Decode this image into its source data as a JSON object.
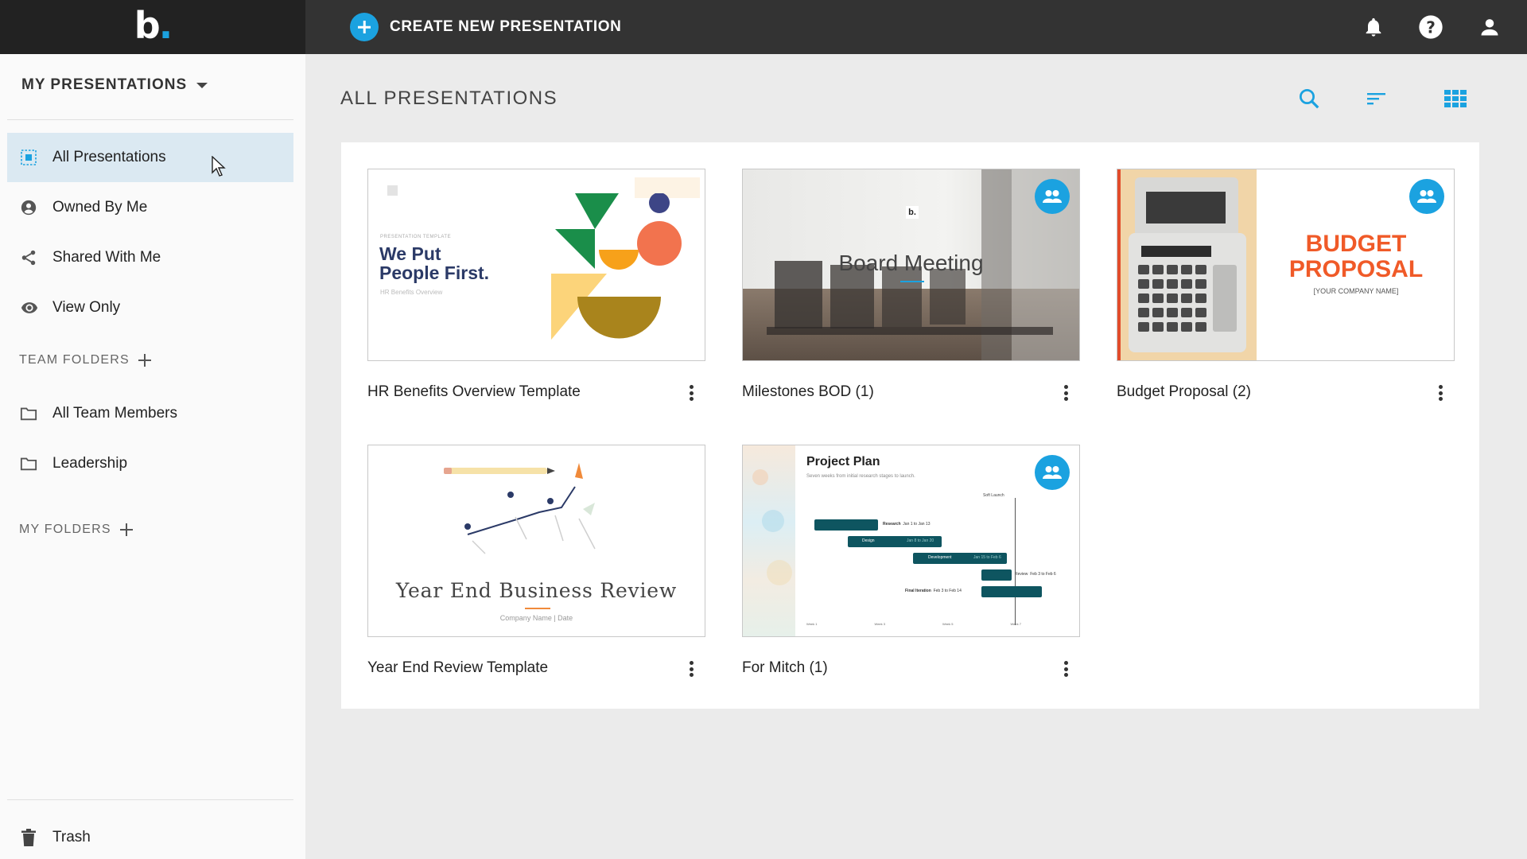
{
  "app": {
    "logo_text": "b",
    "accent": "#1ba2e0"
  },
  "topbar": {
    "create_label": "CREATE NEW PRESENTATION",
    "icons": [
      "bell-icon",
      "help-icon",
      "user-icon"
    ]
  },
  "sidebar": {
    "switcher_label": "MY PRESENTATIONS",
    "items": [
      {
        "label": "All Presentations",
        "icon": "all-presentations-icon",
        "active": true
      },
      {
        "label": "Owned By Me",
        "icon": "user-circle-icon"
      },
      {
        "label": "Shared With Me",
        "icon": "share-icon"
      },
      {
        "label": "View Only",
        "icon": "eye-icon"
      }
    ],
    "team_folders_label": "TEAM FOLDERS",
    "team_folders": [
      {
        "label": "All Team Members",
        "icon": "folder-icon"
      },
      {
        "label": "Leadership",
        "icon": "folder-icon"
      }
    ],
    "my_folders_label": "MY FOLDERS",
    "trash_label": "Trash"
  },
  "main": {
    "title": "ALL PRESENTATIONS",
    "tools": [
      "search-icon",
      "sort-icon",
      "grid-view-icon"
    ],
    "presentations": [
      {
        "title": "HR Benefits Overview Template",
        "shared": false,
        "thumb": {
          "small": "PRESENTATION TEMPLATE",
          "title_line1": "We Put",
          "title_line2": "People First.",
          "sub": "HR Benefits Overview"
        }
      },
      {
        "title": "Milestones BOD (1)",
        "shared": true,
        "thumb": {
          "logo": "b.",
          "title": "Board Meeting"
        }
      },
      {
        "title": "Budget Proposal (2)",
        "shared": true,
        "thumb": {
          "title_line1": "BUDGET",
          "title_line2": "PROPOSAL",
          "sub": "[YOUR COMPANY NAME]"
        }
      },
      {
        "title": "Year End Review Template",
        "shared": false,
        "thumb": {
          "title": "Year End Business Review",
          "sub": "Company Name | Date"
        }
      },
      {
        "title": "For Mitch (1)",
        "shared": true,
        "thumb": {
          "title": "Project Plan",
          "sub": "Seven weeks from initial research stages to launch.",
          "milestone": "Soft Launch",
          "tasks": [
            {
              "name": "Research",
              "dates": "Jan 1 to Jan 13"
            },
            {
              "name": "Design",
              "dates": "Jan 8 to Jan 20"
            },
            {
              "name": "Development",
              "dates": "Jan 15 to Feb 6"
            },
            {
              "name": "Review",
              "dates": "Feb 3 to Feb 6"
            },
            {
              "name": "Final Iteration",
              "dates": "Feb 3 to Feb 14"
            }
          ],
          "weeks": [
            "Week 1",
            "Week 3",
            "Week 5",
            "Week 7"
          ]
        }
      }
    ]
  }
}
